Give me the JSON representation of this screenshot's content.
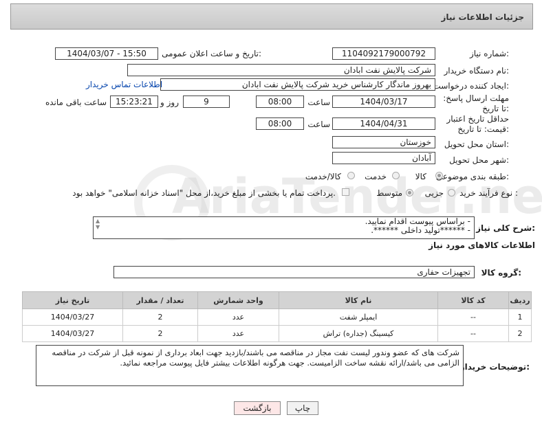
{
  "header": {
    "title": "جزئیات اطلاعات نیاز"
  },
  "form": {
    "need_number_label": "شماره نیاز:",
    "need_number": "1104092179000792",
    "announce_label": "تاریخ و ساعت اعلان عمومی:",
    "announce_value": "1404/03/07 - 15:50",
    "buyer_org_label": "نام دستگاه خریدار:",
    "buyer_org": "شرکت پالایش نفت ابادان",
    "creator_label": "ایجاد کننده درخواست:",
    "creator": "بهروز ماندگار کارشناس خرید شرکت پالایش نفت ابادان",
    "contact_link": "اطلاعات تماس خریدار",
    "reply_label": "مهلت ارسال پاسخ: تا تاریخ:",
    "reply_date": "1404/03/17",
    "time_label": "ساعت",
    "reply_time": "08:00",
    "reply_days": "9",
    "day_and_label": "روز و",
    "remaining_time": "15:23:21",
    "remaining_label": "ساعت باقی مانده",
    "validity_label": "حداقل تاریخ اعتبار قیمت: تا تاریخ:",
    "validity_date": "1404/04/31",
    "validity_time": "08:00",
    "province_label": "استان محل تحویل:",
    "province": "خوزستان",
    "city_label": "شهر محل تحویل:",
    "city": "آبادان",
    "category_label": "طبقه بندی موضوعی:",
    "category_options": [
      "کالا",
      "خدمت",
      "کالا/خدمت"
    ],
    "process_label": "نوع فرآیند خرید :",
    "process_options": [
      "جزیی",
      "متوسط"
    ],
    "payment_note": "پرداخت تمام یا بخشی از مبلغ خرید،از محل \"اسناد خزانه اسلامی\" خواهد بود."
  },
  "description": {
    "label": "شرح کلی نیاز:",
    "line1": "- براساس پیوست اقدام نمایید.",
    "line2": "- ******تولید داخلی ******."
  },
  "goods": {
    "section_title": "اطلاعات کالاهای مورد نیاز",
    "group_label": "گروه کالا:",
    "group_value": "تجهیزات حفاری",
    "columns": [
      "ردیف",
      "کد کالا",
      "نام کالا",
      "واحد شمارش",
      "تعداد / مقدار",
      "تاریخ نیاز"
    ],
    "rows": [
      [
        "1",
        "--",
        "ایمپلر شفت",
        "عدد",
        "2",
        "1404/03/27"
      ],
      [
        "2",
        "--",
        "کیسینگ (جداره) تراش",
        "عدد",
        "2",
        "1404/03/27"
      ]
    ]
  },
  "buyer_notes": {
    "label": "توضیحات خریدار:",
    "text": "شرکت های که عضو وندور لیست نفت مجاز در مناقصه می باشند/بازدید جهت ابعاد برداری از نمونه قبل از شرکت در مناقصه الزامی می باشد/ارائه نقشه ساخت الزامیست. جهت هرگونه اطلاعات بیشتر فایل پیوست مراجعه نمائید."
  },
  "buttons": {
    "print": "چاپ",
    "back": "بازگشت"
  },
  "watermark": {
    "text": "AriaTender.neT"
  },
  "colors": {
    "link": "#0645ad",
    "back_button_bg": "#fde7e7",
    "header_bg": "#d0d0d0"
  }
}
